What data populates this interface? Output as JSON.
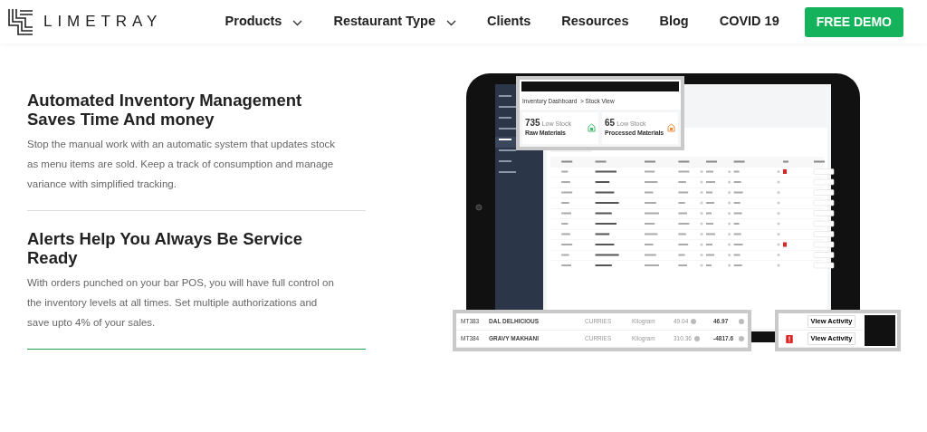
{
  "nav": {
    "logo": "LIMETRAY",
    "items": [
      {
        "label": "Products",
        "has_menu": true
      },
      {
        "label": "Restaurant Type",
        "has_menu": true
      },
      {
        "label": "Clients",
        "has_menu": false
      },
      {
        "label": "Resources",
        "has_menu": false
      },
      {
        "label": "Blog",
        "has_menu": false
      },
      {
        "label": "COVID 19",
        "has_menu": false
      }
    ],
    "cta": "FREE DEMO"
  },
  "features": [
    {
      "title": "Automated Inventory Management Saves Time And money",
      "body": "Stop the manual work with an automatic system that updates stock as menu items are sold. Keep a track of consumption and manage variance with simplified tracking.",
      "selected": false
    },
    {
      "title": "Alerts Help You Always Be Service Ready",
      "body": "With orders punched on your bar POS, you will have full control on the inventory levels at all times. Set multiple authorizations and save upto 4% of your sales.",
      "selected": true
    }
  ],
  "mockup": {
    "popup": {
      "breadcrumb": "Inventory Dashboard  > Stock View",
      "stats": [
        {
          "value": "735",
          "caption": "Low Stock",
          "label": "Raw Materials",
          "color": "#3dbb6b"
        },
        {
          "value": "65",
          "caption": "Low Stock",
          "label": "Processed Materials",
          "color": "#f08a3c"
        }
      ]
    },
    "zoom_rows": [
      {
        "id": "MT383",
        "name": "DAL DELHICIOUS",
        "category": "CURRIES",
        "unit": "Kilogram",
        "cost": "49.04",
        "available": "46.97",
        "alert": false,
        "action": "View Activity"
      },
      {
        "id": "MT384",
        "name": "GRAVY MAKHANI",
        "category": "CURRIES",
        "unit": "Kilogram",
        "cost": "310.36",
        "available": "-4817.6",
        "alert": true,
        "action": "View Activity"
      }
    ]
  }
}
